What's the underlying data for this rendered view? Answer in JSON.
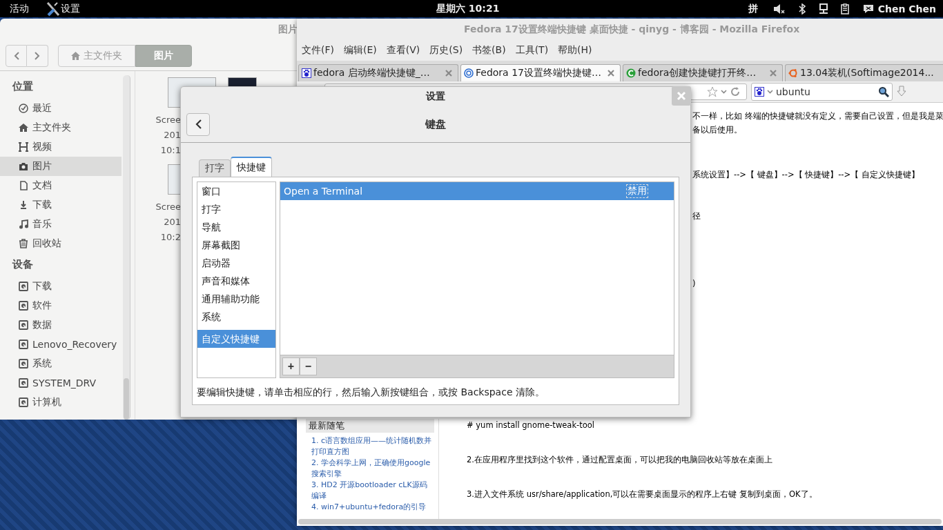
{
  "top_bar": {
    "activities": "活动",
    "app_menu": "设置",
    "clock": "星期六 10:21",
    "input_method": "拼",
    "user": "Chen Chen"
  },
  "files_window": {
    "title": "图片",
    "path": [
      {
        "label": "主文件夹",
        "selected": false
      },
      {
        "label": "图片",
        "selected": true
      }
    ],
    "sidebar": [
      {
        "heading": "位置",
        "items": [
          {
            "label": "最近",
            "selected": false
          },
          {
            "label": "主文件夹",
            "selected": false
          },
          {
            "label": "视频",
            "selected": false
          },
          {
            "label": "图片",
            "selected": true
          },
          {
            "label": "文档",
            "selected": false
          },
          {
            "label": "下载",
            "selected": false
          },
          {
            "label": "音乐",
            "selected": false
          },
          {
            "label": "回收站",
            "selected": false
          }
        ]
      },
      {
        "heading": "设备",
        "items": [
          {
            "label": "下载",
            "selected": false
          },
          {
            "label": "软件",
            "selected": false
          },
          {
            "label": "数据",
            "selected": false
          },
          {
            "label": "Lenovo_Recovery",
            "selected": false
          },
          {
            "label": "系统",
            "selected": false
          },
          {
            "label": "SYSTEM_DRV",
            "selected": false
          },
          {
            "label": "计算机",
            "selected": false
          }
        ]
      }
    ],
    "files": [
      {
        "lines": [
          "Scree",
          "201",
          "10:1"
        ]
      },
      {
        "lines": [
          "Scree",
          "201",
          "10:2"
        ]
      }
    ]
  },
  "firefox": {
    "title": "Fedora 17设置终端快捷键 桌面快捷 - qinyg - 博客园 - Mozilla Firefox",
    "menu": [
      "文件(F)",
      "编辑(E)",
      "查看(V)",
      "历史(S)",
      "书签(B)",
      "工具(T)",
      "帮助(H)"
    ],
    "tabs": [
      {
        "title": "fedora 启动终端快捷键_…",
        "selected": false,
        "closable": true
      },
      {
        "title": "Fedora 17设置终端快捷键…",
        "selected": true,
        "closable": true
      },
      {
        "title": "fedora创建快捷键打开终…",
        "selected": false,
        "closable": true
      },
      {
        "title": "13.04装机(Softimage2014...",
        "selected": false,
        "closable": false
      }
    ],
    "search": {
      "value": "ubuntu"
    },
    "article_upper": [
      "不一样，比如 终端的快捷键就没有定义，需要自己设置，但是我是菜",
      "备以后使用。",
      "系统设置】-->【 键盘】-->【 快捷键】-->【 自定义快捷键】",
      "径",
      ")"
    ],
    "blog_sidebar": {
      "heading": "最新随笔",
      "links": [
        "1. c语言数组应用——统计随机数并打印直方图",
        "2. 学会科学上网，正确使用google搜索引擎",
        "3. HD2 开源bootloader cLK源码编译",
        "4. win7+ubuntu+fedora的引导"
      ]
    },
    "article_lower": [
      "# yum install gnome-tweak-tool",
      "2.在应用程序里找到这个软件，通过配置桌面，可以把我的电脑回收站等放在桌面上",
      "3.进入文件系统 usr/share/application,可以在需要桌面显示的程序上右键 复制到桌面，OK了。"
    ]
  },
  "dialog": {
    "title": "设置",
    "panel_title": "键盘",
    "tabs": [
      {
        "label": "打字",
        "selected": false
      },
      {
        "label": "快捷键",
        "selected": true
      }
    ],
    "categories": [
      {
        "label": "窗口",
        "selected": false
      },
      {
        "label": "打字",
        "selected": false
      },
      {
        "label": "导航",
        "selected": false
      },
      {
        "label": "屏幕截图",
        "selected": false
      },
      {
        "label": "启动器",
        "selected": false
      },
      {
        "label": "声音和媒体",
        "selected": false
      },
      {
        "label": "通用辅助功能",
        "selected": false
      },
      {
        "label": "系统",
        "selected": false
      },
      {
        "label": "自定义快捷键",
        "selected": true
      }
    ],
    "shortcuts": [
      {
        "name": "Open a Terminal",
        "accelerator": "禁用",
        "selected": true
      }
    ],
    "toolbar": [
      "+",
      "−"
    ],
    "hint": "要编辑快捷键，请单击相应的行，然后输入新按键组合，或按 Backspace 清除。"
  }
}
